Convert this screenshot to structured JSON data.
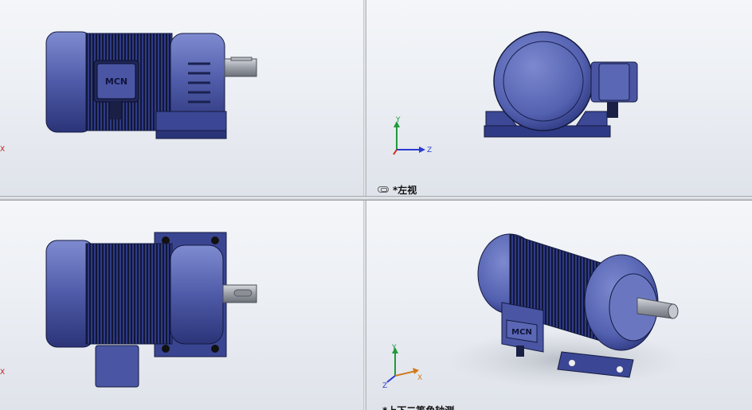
{
  "app": "SolidWorks",
  "views": {
    "top_left": {
      "label": ""
    },
    "top_right": {
      "label": "*左视"
    },
    "bottom_left": {
      "label": ""
    },
    "bottom_right": {
      "label": "*上下二等角轴测"
    }
  },
  "motor_logo_text": "MCN",
  "triad": {
    "x": "X",
    "y": "Y",
    "z": "Z"
  },
  "colors": {
    "motor_body": "#5a67b4",
    "motor_dark": "#1a2150",
    "motor_light": "#8f9bd8",
    "shaft": "#a8abb2",
    "triad_x": "#d02a1a",
    "triad_y": "#1f9a3a",
    "triad_z": "#2a3bd0"
  },
  "icons": [
    "link-icon"
  ]
}
